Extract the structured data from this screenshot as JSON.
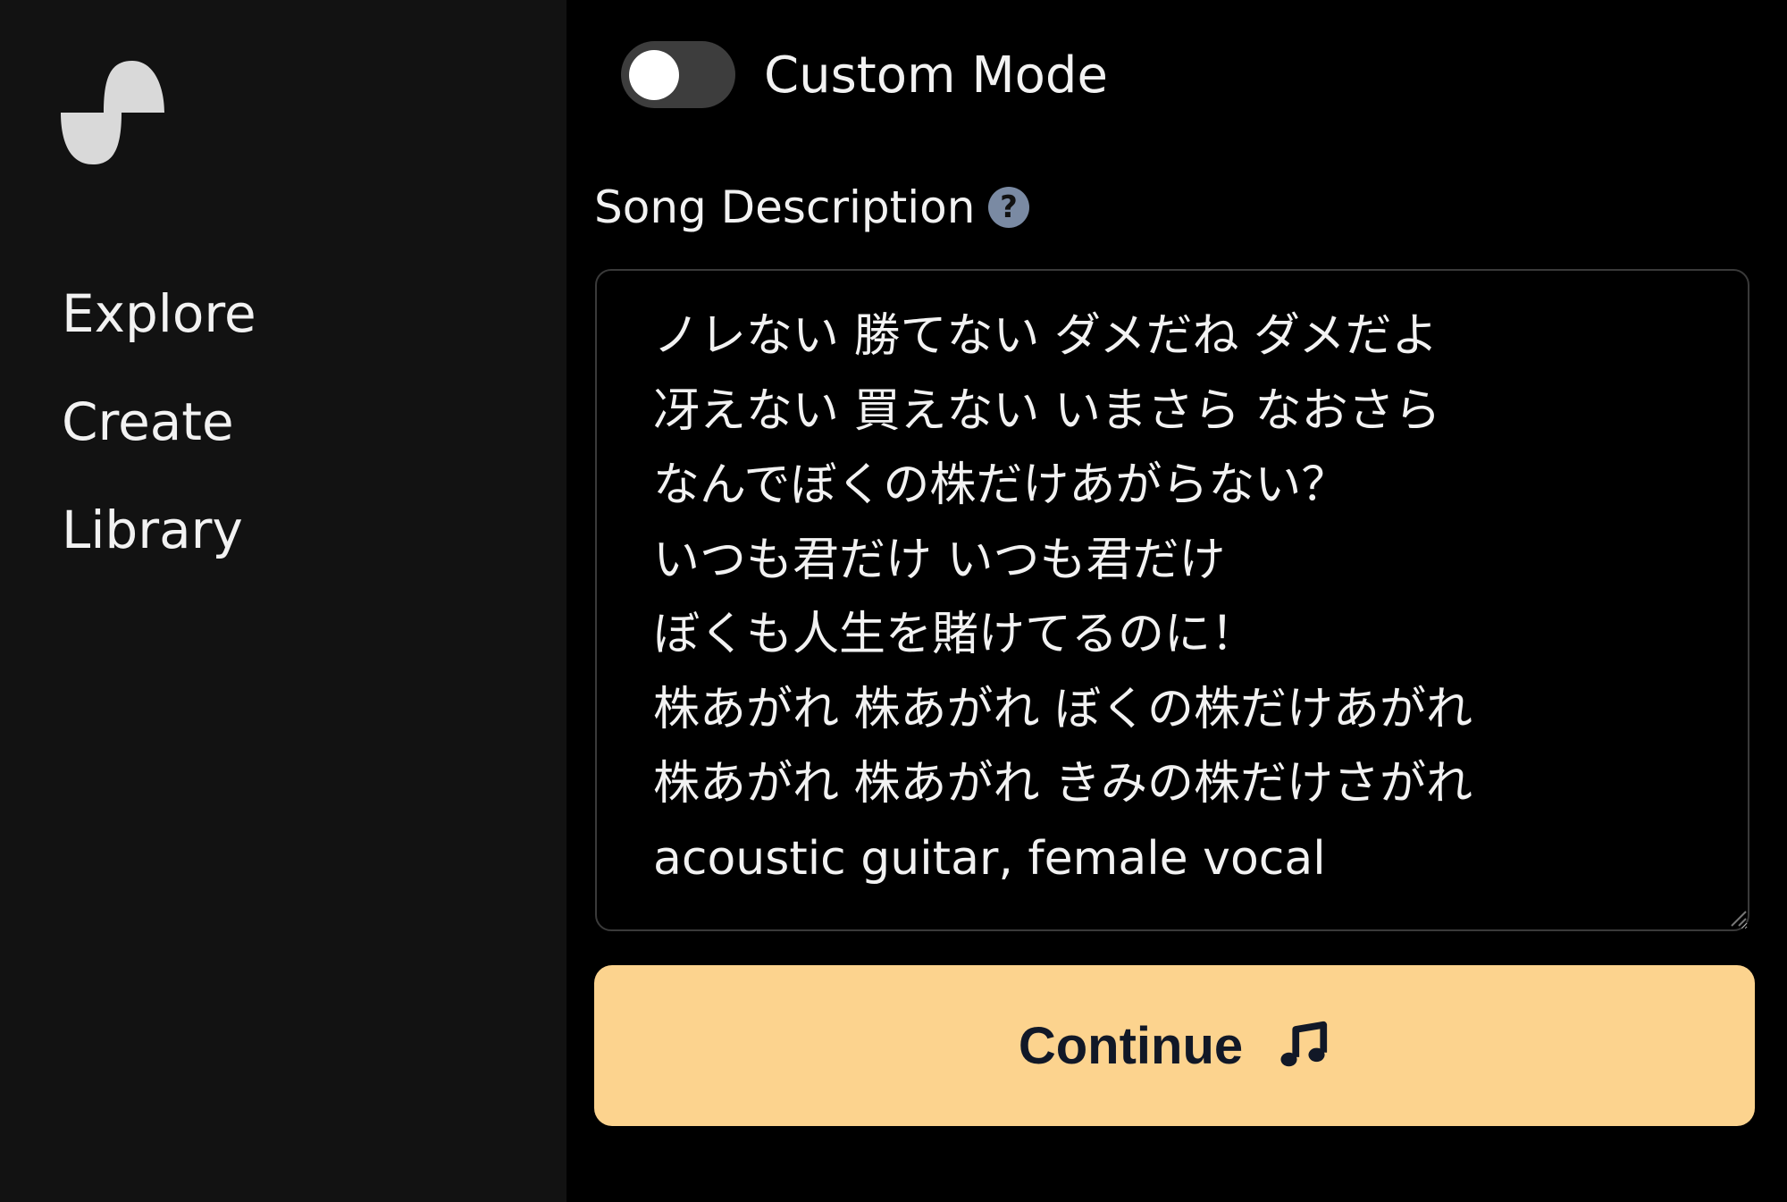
{
  "sidebar": {
    "items": [
      {
        "label": "Explore"
      },
      {
        "label": "Create"
      },
      {
        "label": "Library"
      }
    ],
    "logo_icon": "wave-logo"
  },
  "main": {
    "custom_mode": {
      "label": "Custom Mode",
      "enabled": false
    },
    "song_description": {
      "label": "Song Description",
      "help_icon": "question-circle-icon",
      "value": "ノレない 勝てない ダメだね ダメだよ\n冴えない 買えない いまさら なおさら\nなんでぼくの株だけあがらない？\nいつも君だけ いつも君だけ\nぼくも人生を賭けてるのに！\n株あがれ 株あがれ ぼくの株だけあがれ\n株あがれ 株あがれ きみの株だけさがれ\nacoustic guitar, female vocal"
    },
    "continue_button": {
      "label": "Continue",
      "icon": "music-note-icon",
      "color": "#fcd38e"
    }
  }
}
